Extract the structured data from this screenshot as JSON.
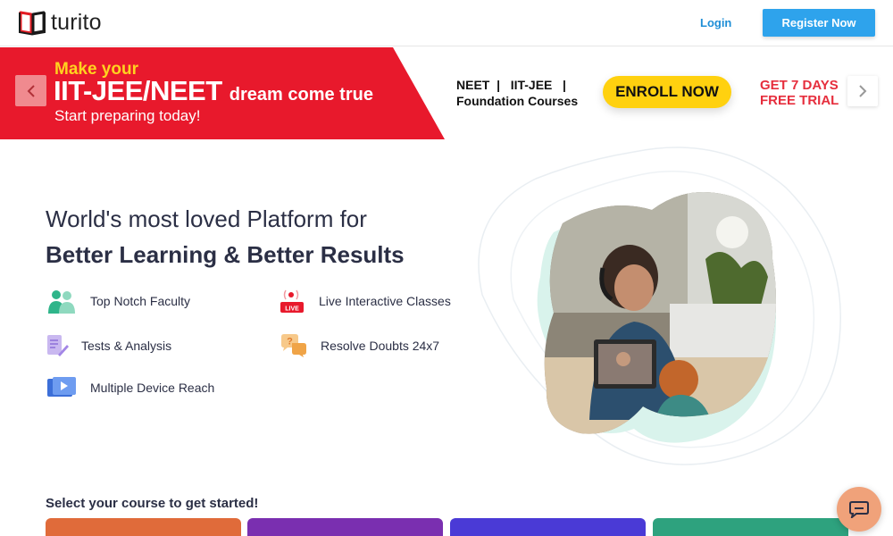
{
  "header": {
    "logo_text": "turito",
    "login_label": "Login",
    "register_label": "Register Now"
  },
  "banner": {
    "make_your": "Make your",
    "headline": "IIT-JEE/NEET",
    "dream": "dream come true",
    "subline": "Start preparing today!",
    "courses_line1": "NEET  |   IIT-JEE   |",
    "courses_line2": "Foundation Courses",
    "enroll_label": "ENROLL NOW",
    "trial_line1": "GET 7 DAYS",
    "trial_line2": "FREE TRIAL",
    "colors": {
      "red": "#e8192c",
      "yellow": "#ffd10f"
    }
  },
  "hero": {
    "line1": "World's most loved Platform for",
    "line2": "Better Learning & Better Results"
  },
  "features": [
    {
      "label": "Top Notch Faculty",
      "icon": "faculty-icon"
    },
    {
      "label": "Live Interactive Classes",
      "icon": "live-icon",
      "badge": "LIVE"
    },
    {
      "label": "Tests & Analysis",
      "icon": "tests-icon"
    },
    {
      "label": "Resolve Doubts 24x7",
      "icon": "doubts-icon"
    },
    {
      "label": "Multiple Device Reach",
      "icon": "device-icon"
    }
  ],
  "courses": {
    "prompt": "Select your course to get started!",
    "card_colors": [
      "#e06b3a",
      "#7a2fb0",
      "#4a3ad6",
      "#2ea27e"
    ]
  }
}
